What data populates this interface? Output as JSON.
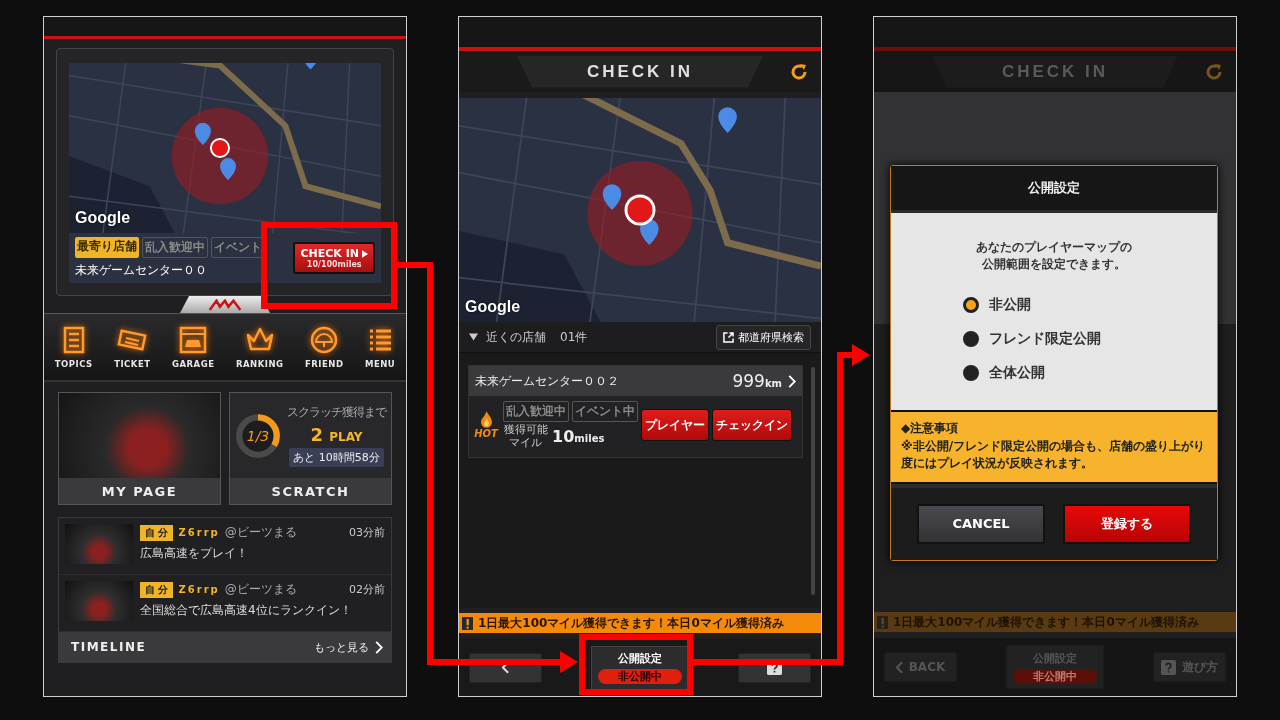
{
  "home_screen": {
    "map": {
      "attribution": "Google"
    },
    "store_tags": [
      {
        "label": "最寄り店舗",
        "active": true
      },
      {
        "label": "乱入歓迎中",
        "active": false
      },
      {
        "label": "イベント",
        "active": false
      }
    ],
    "store_name": "未来ゲームセンター００",
    "check_in_button": {
      "label": "CHECK IN",
      "miles": "10/100miles"
    },
    "nav": [
      {
        "label": "TOPICS",
        "kind": "topics"
      },
      {
        "label": "TICKET",
        "kind": "ticket"
      },
      {
        "label": "GARAGE",
        "kind": "garage"
      },
      {
        "label": "RANKING",
        "kind": "ranking"
      },
      {
        "label": "FRIEND",
        "kind": "friend"
      },
      {
        "label": "MENU",
        "kind": "menu"
      }
    ],
    "my_page": {
      "label": "MY PAGE"
    },
    "scratch": {
      "label": "SCRATCH",
      "caption": "スクラッチ獲得まで",
      "progress_text": "1/3",
      "level": 0.333,
      "count": "2",
      "unit": "PLAY",
      "remaining": "あと 10時間58分"
    },
    "timeline": {
      "title": "TIMELINE",
      "more": "もっと見る",
      "posts": [
        {
          "badge": "自 分",
          "name": "Z6rrp",
          "handle": "@ビーツまる",
          "time": "03分前",
          "text": "広島高速をプレイ！"
        },
        {
          "badge": "自 分",
          "name": "Z6rrp",
          "handle": "@ビーツまる",
          "time": "02分前",
          "text": "全国総合で広島高速4位にランクイン！"
        }
      ]
    }
  },
  "check_in_screen": {
    "title": "CHECK IN",
    "map": {
      "attribution": "Google"
    },
    "nearby_label": "近くの店舗",
    "nearby_count": "01件",
    "prefecture_search": "都道府県検索",
    "store": {
      "name": "未来ゲームセンター００２",
      "distance": "999",
      "distance_unit": "km",
      "tags": [
        {
          "label": "乱入歓迎中",
          "active": false
        },
        {
          "label": "イベント中",
          "active": false
        }
      ],
      "hot_label": "HOT",
      "miles_caption": "獲得可能マイル",
      "miles": "10",
      "miles_unit": "miles",
      "buttons": [
        "プレイヤー",
        "チェックイン"
      ]
    },
    "notice": "1日最大100マイル獲得できます！本日0マイル獲得済み",
    "privacy_button": {
      "label": "公開設定",
      "status": "非公開中"
    }
  },
  "privacy_dialog_screen": {
    "title": "CHECK IN",
    "dialog": {
      "title": "公開設定",
      "message": "あなたのプレイヤーマップの公開範囲を設定できます。",
      "options": [
        {
          "label": "非公開",
          "selected": true
        },
        {
          "label": "フレンド限定公開",
          "selected": false
        },
        {
          "label": "全体公開",
          "selected": false
        }
      ],
      "note_title": "◆注意事項",
      "note_text": "※非公開/フレンド限定公開の場合も、店舗の盛り上がり度にはプレイ状況が反映されます。",
      "buttons": [
        {
          "label": "CANCEL",
          "kind": "cancel"
        },
        {
          "label": "登録する",
          "kind": "confirm"
        }
      ]
    },
    "notice": "1日最大100マイル獲得できます！本日0マイル獲得済み",
    "back": "BACK",
    "privacy_button": {
      "label": "公開設定",
      "status": "非公開中"
    },
    "help": "遊び方"
  }
}
